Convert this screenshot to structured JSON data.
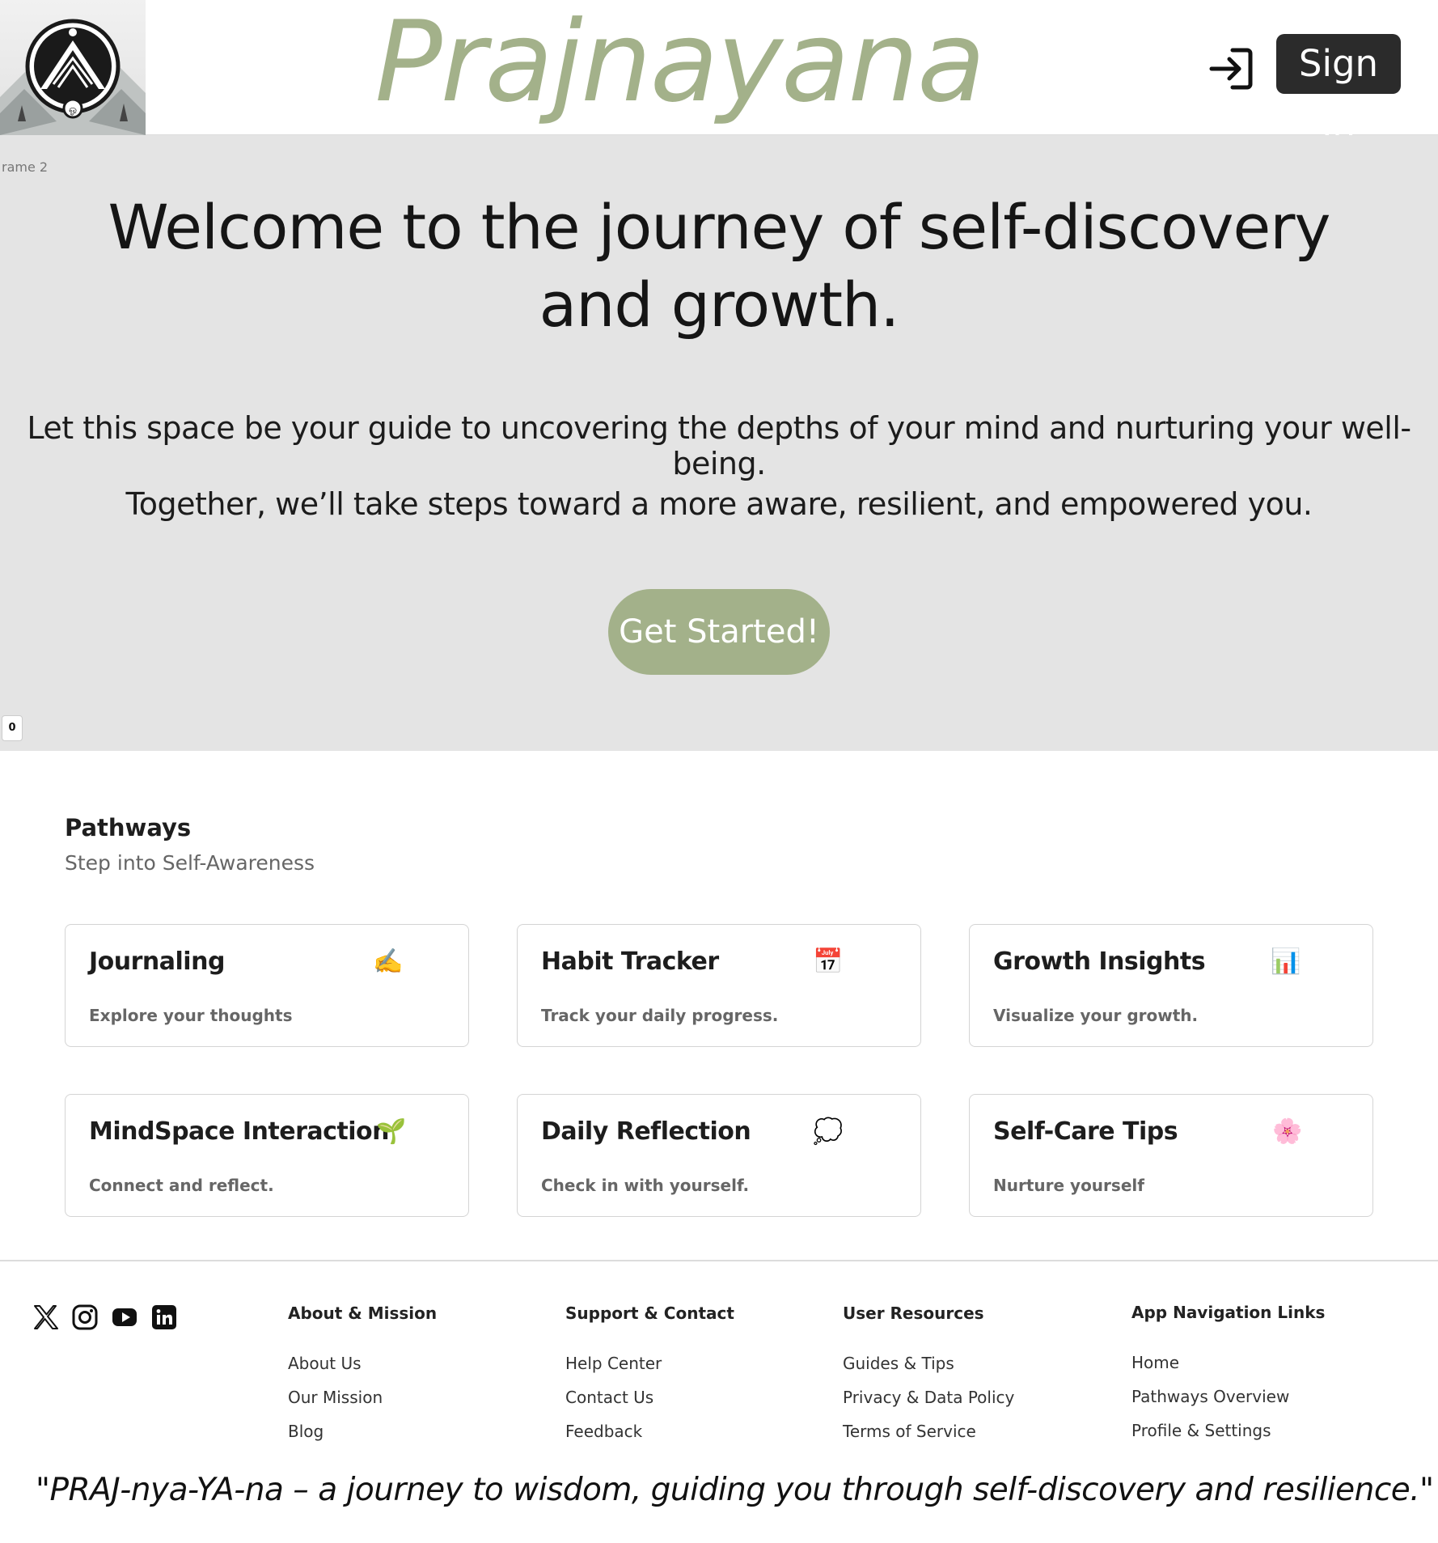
{
  "header": {
    "brand": "Prajnayana",
    "signin_label": "Sign In"
  },
  "hero": {
    "frame_label": "rame 2",
    "title": "Welcome to the journey of self-discovery and growth.",
    "line1": "Let this space be your guide to uncovering the depths of your mind and nurturing your well-being.",
    "line2": "Together, we’ll take steps toward a more aware, resilient, and empowered you.",
    "cta_label": "Get Started!",
    "badge": "0"
  },
  "pathways": {
    "title": "Pathways",
    "subtitle": "Step into Self-Awareness",
    "cards": [
      {
        "title": "Journaling",
        "icon": "✍️",
        "icon_name": "writing-hand-icon",
        "desc": "Explore your thoughts"
      },
      {
        "title": "Habit Tracker",
        "icon": "📅",
        "icon_name": "calendar-icon",
        "desc": "Track your daily progress."
      },
      {
        "title": "Growth Insights",
        "icon": "📊",
        "icon_name": "bar-chart-icon",
        "desc": "Visualize your growth."
      },
      {
        "title": "MindSpace Interaction",
        "icon": "🌱",
        "icon_name": "seedling-icon",
        "desc": "Connect and reflect."
      },
      {
        "title": "Daily Reflection",
        "icon": "💭",
        "icon_name": "thought-bubble-icon",
        "desc": "Check in with yourself."
      },
      {
        "title": "Self-Care Tips",
        "icon": "🌸",
        "icon_name": "cherry-blossom-icon",
        "desc": "Nurture yourself"
      }
    ]
  },
  "footer": {
    "social": [
      "x-icon",
      "instagram-icon",
      "youtube-icon",
      "linkedin-icon"
    ],
    "columns": [
      {
        "heading": "About & Mission",
        "links": [
          "About Us",
          "Our Mission",
          "Blog"
        ]
      },
      {
        "heading": "Support & Contact",
        "links": [
          "Help Center",
          "Contact Us",
          "Feedback"
        ]
      },
      {
        "heading": "User Resources",
        "links": [
          "Guides & Tips",
          "Privacy & Data Policy",
          "Terms of Service"
        ]
      },
      {
        "heading": "App Navigation Links",
        "links": [
          "Home",
          "Pathways Overview",
          "Profile & Settings"
        ]
      }
    ],
    "quote": "\"PRAJ-nya-YA-na – a journey to wisdom, guiding you through self-discovery and resilience.\""
  }
}
